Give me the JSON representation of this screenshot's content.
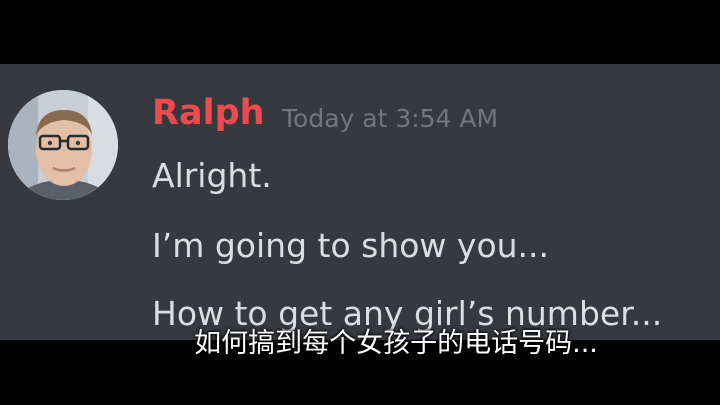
{
  "message": {
    "author": "Ralph",
    "timestamp": "Today at 3:54 AM",
    "lines": [
      "Alright.",
      "I’m going to show you...",
      "How to get any girl’s number..."
    ]
  },
  "subtitle": "如何搞到每个女孩子的电话号码...",
  "colors": {
    "chat_background": "#36393f",
    "author_name": "#f04b4c",
    "timestamp": "#72767d",
    "message_text": "#dcddde",
    "letterbox": "#000000"
  }
}
